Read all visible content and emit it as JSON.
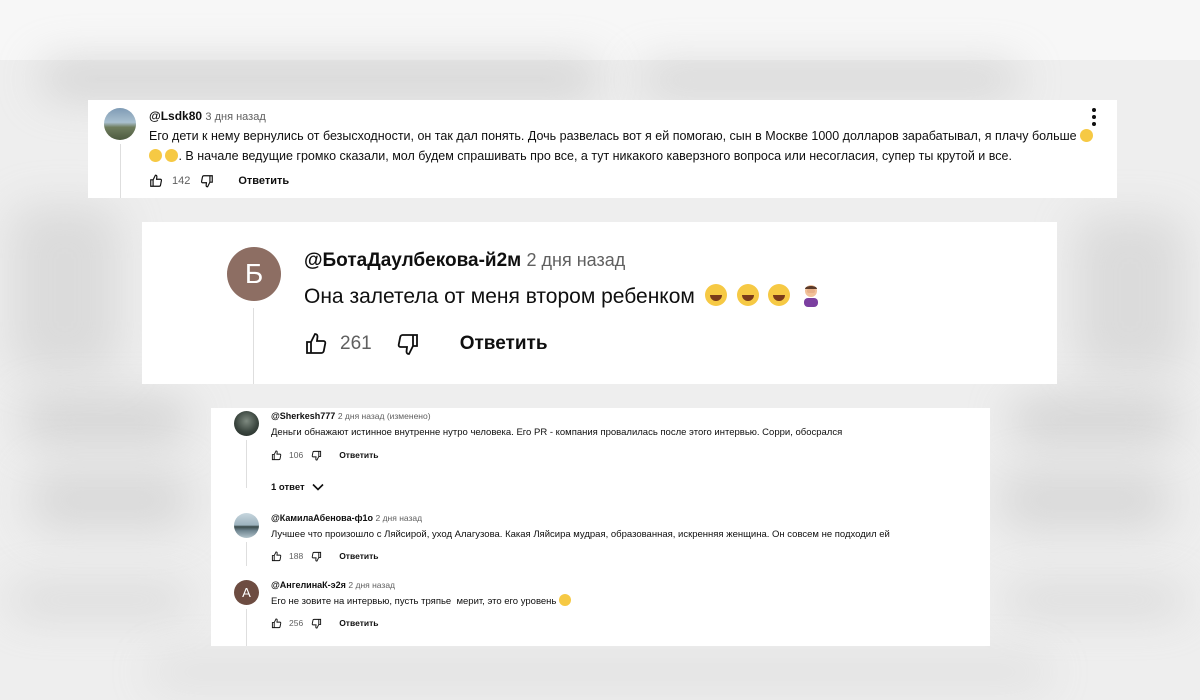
{
  "comment1": {
    "author": "@Lsdk80",
    "time": "3 дня назад",
    "text_a": "Его дети к нему вернулись от безысходности, он так дал понять. Дочь развелась вот я ей помогаю, сын в Москве 1000 долларов зарабатывал, я плачу больше",
    "text_b": ". В начале ведущие громко сказали, мол будем спрашивать про все, а тут никакого каверзного вопроса или несогласия, супер ты крутой и все.",
    "likes": "142",
    "reply_label": "Ответить"
  },
  "comment2": {
    "author": "@БотаДаулбекова-й2м",
    "time": "2 дня назад",
    "avatar_letter": "Б",
    "text": "Она залетела от меня втором ребенком",
    "likes": "261",
    "reply_label": "Ответить"
  },
  "comment3": {
    "author": "@Sherkesh777",
    "time": "2 дня назад (изменено)",
    "text": "Деньги обнажают истинное внутренне нутро человека. Его PR - компания провалилась после этого интервью. Сорри, обосрался",
    "likes": "106",
    "reply_label": "Ответить",
    "replies_toggle": "1 ответ"
  },
  "comment4": {
    "author": "@КамилаАбенова-ф1о",
    "time": "2 дня назад",
    "text": "Лучшее что произошло с Ляйсирой, уход Алагузова. Какая Ляйсира мудрая, образованная, искренняя женщина. Он совсем не подходил ей",
    "likes": "188",
    "reply_label": "Ответить"
  },
  "comment5": {
    "author": "@АнгелинаК-э2я",
    "time": "2 дня назад",
    "avatar_letter": "А",
    "text": "Его не зовите на интервью, пусть тряпье  мерит, это его уровень",
    "likes": "256",
    "reply_label": "Ответить"
  },
  "colors": {
    "avatar_b": "#8d6e63",
    "avatar_a": "#6d4c41",
    "time_gray": "#606060",
    "line_gray": "#dedede"
  }
}
